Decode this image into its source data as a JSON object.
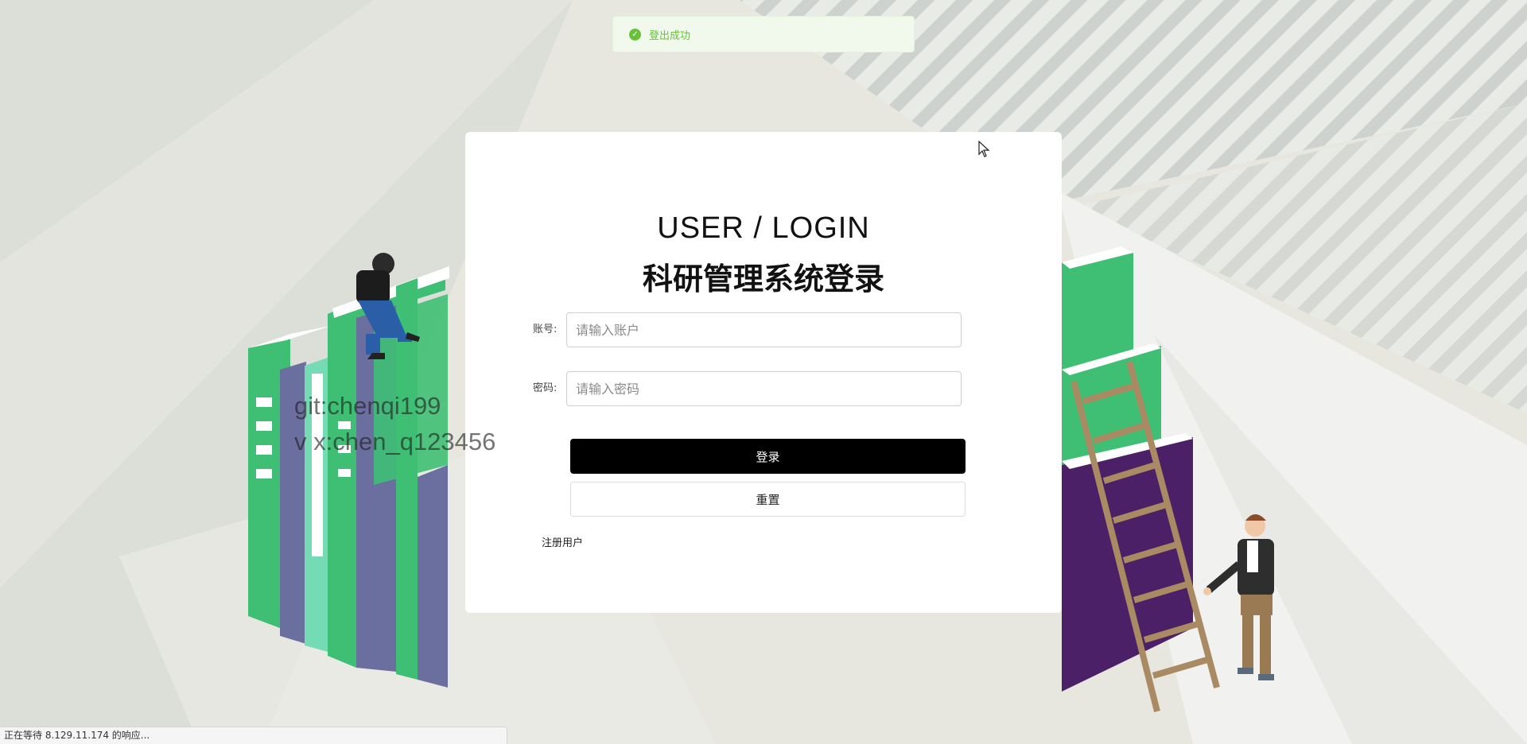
{
  "toast": {
    "message": "登出成功",
    "icon": "check-circle-icon",
    "color": "#67c23a"
  },
  "login": {
    "title_en": "USER / LOGIN",
    "title_cn": "科研管理系统登录",
    "account_label": "账号:",
    "account_placeholder": "请输入账户",
    "account_value": "",
    "password_label": "密码:",
    "password_placeholder": "请输入密码",
    "password_value": "",
    "login_button": "登录",
    "reset_button": "重置",
    "register_link": "注册用户"
  },
  "watermark": {
    "line1": "git:chenqi199",
    "line2": "v x:chen_q123456"
  },
  "statusbar": {
    "text": "正在等待 8.129.11.174 的响应..."
  },
  "colors": {
    "book_green": "#3fbf74",
    "book_dark_green": "#2fa862",
    "book_purple": "#6b6f9f",
    "book_dark_purple": "#4b2066",
    "button_black": "#000000"
  }
}
